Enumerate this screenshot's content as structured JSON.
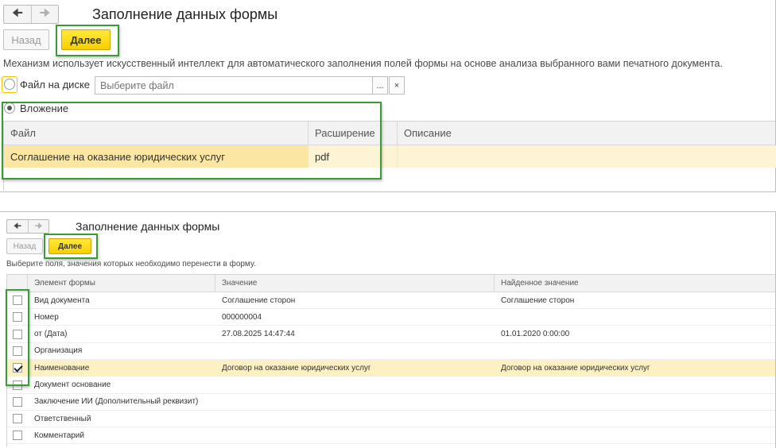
{
  "panel1": {
    "title": "Заполнение данных формы",
    "nav": {
      "back_icon": "arrow-left-icon",
      "forward_icon": "arrow-right-icon"
    },
    "buttons": {
      "back_label": "Назад",
      "next_label": "Далее"
    },
    "description": "Механизм использует искусственный интеллект для автоматического заполнения полей формы на основе анализа выбранного вами печатного документа.",
    "file_option": {
      "label": "Файл на диске",
      "placeholder": "Выберите файл",
      "select_label": "...",
      "clear_label": "×",
      "selected": false
    },
    "attachment_option": {
      "label": "Вложение",
      "selected": true
    },
    "table": {
      "columns": [
        "Файл",
        "Расширение",
        "Описание"
      ],
      "rows": [
        {
          "file": "Соглашение на оказание юридических услуг",
          "ext": "pdf",
          "desc": ""
        }
      ]
    }
  },
  "panel2": {
    "title": "Заполнение данных формы",
    "buttons": {
      "back_label": "Назад",
      "next_label": "Далее"
    },
    "description": "Выберите поля, значения которых необходимо перенести в форму.",
    "table": {
      "columns": [
        "Элемент формы",
        "Значение",
        "Найденное значение"
      ],
      "rows": [
        {
          "checked": false,
          "element": "Вид документа",
          "value": "Соглашение сторон",
          "found": "Соглашение сторон"
        },
        {
          "checked": false,
          "element": "Номер",
          "value": "000000004",
          "found": ""
        },
        {
          "checked": false,
          "element": "от (Дата)",
          "value": "27.08.2025 14:47:44",
          "found": "01.01.2020 0:00:00"
        },
        {
          "checked": false,
          "element": "Организация",
          "value": "",
          "found": ""
        },
        {
          "checked": true,
          "element": "Наименование",
          "value": "Договор на оказание юридических услуг",
          "found": "Договор на оказание юридических услуг"
        },
        {
          "checked": false,
          "element": "Документ основание",
          "value": "",
          "found": ""
        },
        {
          "checked": false,
          "element": "Заключение ИИ (Дополнительный реквизит)",
          "value": "",
          "found": ""
        },
        {
          "checked": false,
          "element": "Ответственный",
          "value": "",
          "found": ""
        },
        {
          "checked": false,
          "element": "Комментарий",
          "value": "",
          "found": ""
        }
      ]
    }
  },
  "colors": {
    "accent_yellow": "#f7cf00",
    "highlight_green": "#3a9a35",
    "selected_row": "#fbe6a3"
  }
}
